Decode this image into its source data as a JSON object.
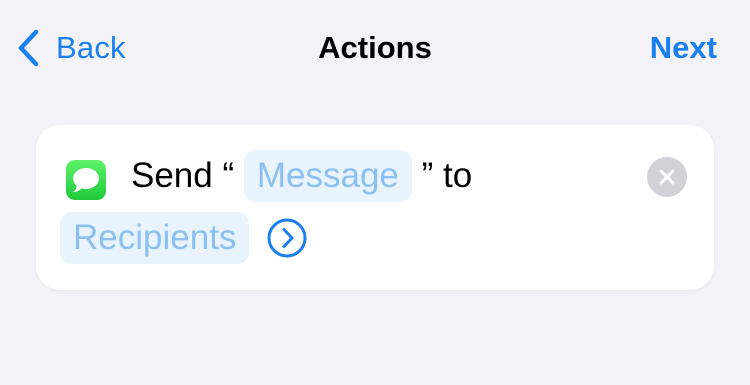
{
  "nav": {
    "back_label": "Back",
    "title": "Actions",
    "next_label": "Next"
  },
  "action": {
    "app_icon": "messages-icon",
    "send_word": "Send",
    "open_quote": " “ ",
    "message_token": "Message",
    "close_quote_to": " ” to",
    "recipients_token": "Recipients",
    "expand_icon": "chevron-right-circle-icon",
    "remove_icon": "close-icon"
  },
  "colors": {
    "accent": "#1a7ff0",
    "background": "#f2f2f7",
    "card": "#ffffff",
    "token_bg": "#e9f3fd",
    "token_text": "#8bc0f3",
    "messages_green": "#2ed14a"
  }
}
